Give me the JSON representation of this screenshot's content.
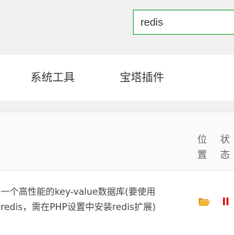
{
  "search": {
    "value": "redis"
  },
  "tabs": [
    {
      "label": "系统工具"
    },
    {
      "label": "宝塔插件"
    }
  ],
  "table": {
    "headers": {
      "location": "位置",
      "status": "状态"
    },
    "rows": [
      {
        "description_line1": "是一个高性能的key-value数据库(要使用",
        "description_line2": "接redis，需在PHP设置中安装redis扩展)",
        "location_icon": "folder-icon",
        "status_icon": "pause-icon"
      }
    ]
  },
  "colors": {
    "accent": "#20a53a",
    "status_stopped": "#e01e1e",
    "folder": "#f0b530"
  }
}
